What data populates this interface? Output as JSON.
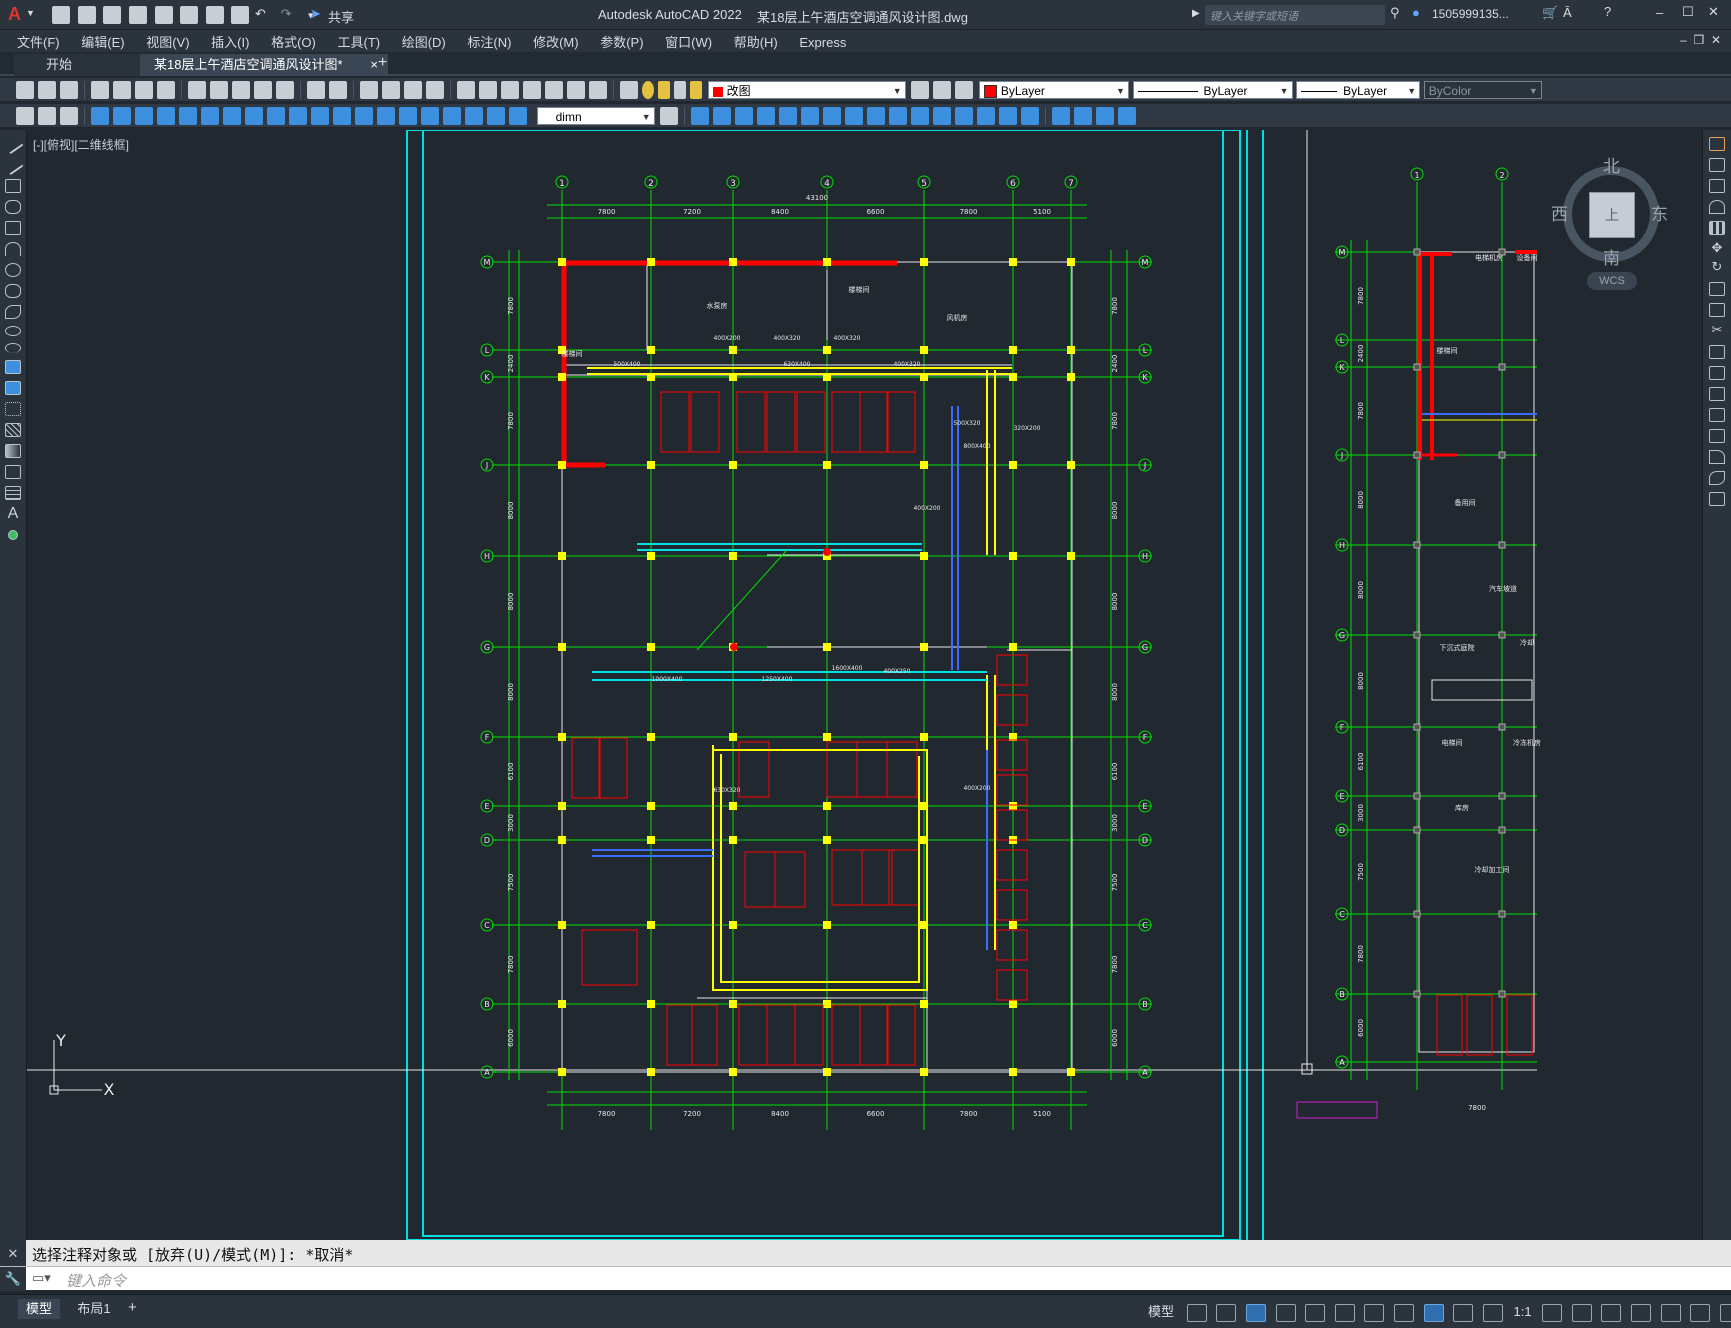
{
  "app_title": "Autodesk AutoCAD 2022",
  "file_title": "某18层上午酒店空调通风设计图.dwg",
  "share_label": "共享",
  "search_placeholder": "键入关键字或短语",
  "user_name": "1505999135...",
  "menu": [
    "文件(F)",
    "编辑(E)",
    "视图(V)",
    "插入(I)",
    "格式(O)",
    "工具(T)",
    "绘图(D)",
    "标注(N)",
    "修改(M)",
    "参数(P)",
    "窗口(W)",
    "帮助(H)",
    "Express"
  ],
  "tabs": {
    "start": "开始",
    "doc": "某18层上午酒店空调通风设计图*",
    "close": "×",
    "new": "+"
  },
  "toolbar": {
    "layer_value": "改图",
    "color_value": "ByLayer",
    "linetype_value": "ByLayer",
    "lineweight_value": "ByLayer",
    "plotstyle_value": "ByColor",
    "dimstyle_value": "dimn"
  },
  "viewport_label": "[-][俯视][二维线框]",
  "viewcube": {
    "north": "北",
    "south": "南",
    "east": "东",
    "west": "西",
    "top": "上",
    "wcs": "WCS"
  },
  "ucs": {
    "x": "X",
    "y": "Y"
  },
  "drawing": {
    "grid_columns": [
      "1",
      "2",
      "3",
      "4",
      "5",
      "6",
      "7"
    ],
    "grid_rows": [
      "M",
      "L",
      "K",
      "J",
      "H",
      "G",
      "F",
      "E",
      "D",
      "C",
      "B",
      "A"
    ],
    "col_spacing": [
      "7800",
      "7200",
      "8400",
      "6600",
      "7800",
      "5100"
    ],
    "overall_width": "43100",
    "row_spacing": [
      "7800",
      "2400",
      "7800",
      "8000",
      "8000",
      "8000",
      "6100",
      "3000",
      "7500",
      "7800",
      "6000"
    ],
    "labels": {
      "rooms": [
        "水泵房",
        "楼梯间",
        "楼梯间",
        "风机房"
      ],
      "ducts": [
        "400X200",
        "400X320",
        "400X320",
        "500X400",
        "630X400",
        "400X320",
        "500X320",
        "800X400",
        "400X200",
        "320X200",
        "1000X400",
        "1250X400",
        "1600X400",
        "400X250",
        "630X320",
        "400X200"
      ]
    }
  },
  "right_drawing": {
    "rows": [
      "M",
      "L",
      "K",
      "J",
      "H",
      "G",
      "F",
      "E",
      "D",
      "C",
      "B",
      "A"
    ],
    "row_spacing": [
      "7800",
      "2400",
      "7800",
      "8000",
      "8000",
      "8000",
      "6100",
      "3000",
      "7500",
      "7800",
      "6000"
    ],
    "cols": [
      "1",
      "2"
    ],
    "bottom_dim": "7800",
    "rooms": [
      "电梯机房",
      "设备间",
      "楼梯间",
      "备用间",
      "汽车坡道",
      "下沉式庭院",
      "冷却",
      "电梯间",
      "冷冻机房",
      "库房",
      "冷却加工间"
    ]
  },
  "command": {
    "history": "选择注释对象或 [放弃(U)/模式(M)]: *取消*",
    "placeholder": "键入命令"
  },
  "layout_tabs": {
    "model": "模型",
    "layout1": "布局1",
    "add": "+"
  },
  "status": {
    "model": "模型",
    "scale": "1:1"
  },
  "colors": {
    "cyan": "#00e0e0",
    "green": "#00e000",
    "yellow": "#ffff00",
    "red": "#ff0000",
    "blue": "#3a6cff",
    "white": "#e8e8e8",
    "canvas": "#212830"
  }
}
